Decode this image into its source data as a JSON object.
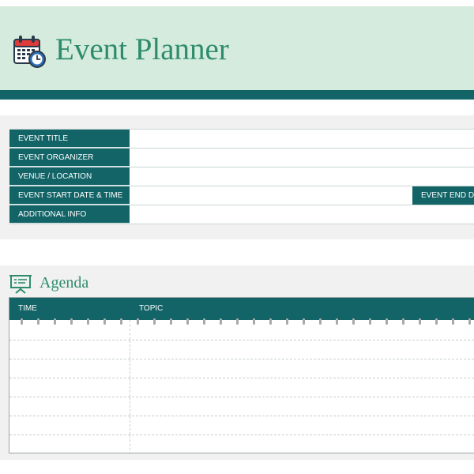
{
  "header": {
    "title": "Event Planner",
    "logo_icon": "calendar-clock-icon",
    "colors": {
      "band": "#d4ebdd",
      "bar": "#136467",
      "title": "#2e8c6e"
    }
  },
  "event_info": {
    "rows": [
      {
        "label": "EVENT TITLE",
        "value": ""
      },
      {
        "label": "EVENT ORGANIZER",
        "value": ""
      },
      {
        "label": "VENUE / LOCATION",
        "value": ""
      },
      {
        "label": "EVENT START DATE & TIME",
        "value": "",
        "secondary_label": "EVENT END DA"
      },
      {
        "label": "ADDITIONAL INFO",
        "value": ""
      }
    ],
    "label_color": "#136467"
  },
  "agenda": {
    "heading": "Agenda",
    "icon": "presentation-board-icon",
    "columns": {
      "time": "TIME",
      "topic": "TOPIC"
    },
    "rows": [
      {
        "time": "",
        "topic": ""
      },
      {
        "time": "",
        "topic": ""
      },
      {
        "time": "",
        "topic": ""
      },
      {
        "time": "",
        "topic": ""
      },
      {
        "time": "",
        "topic": ""
      },
      {
        "time": "",
        "topic": ""
      },
      {
        "time": "",
        "topic": ""
      }
    ]
  }
}
